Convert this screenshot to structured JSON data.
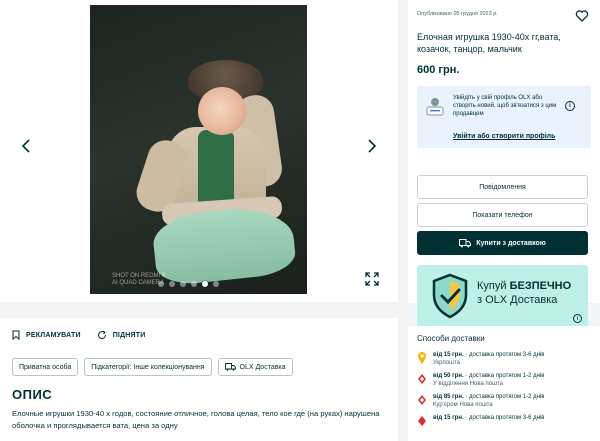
{
  "gallery": {
    "watermark": "SHOT ON REDMI 9\nAI QUAD CAMERA",
    "slide_count": 6,
    "active_slide": 5,
    "prev_icon": "chevron-left-icon",
    "next_icon": "chevron-right-icon",
    "expand_icon": "expand-icon"
  },
  "actions": {
    "promote": "РЕКЛАМУВАТИ",
    "raise": "ПІДНЯТИ"
  },
  "tags": [
    "Приватна особа",
    "Підкатегорії: Інше колекціонування",
    "OLX Доставка"
  ],
  "description": {
    "heading": "ОПИС",
    "text": "Елочные игрушки 1930-40 х годов, состояние отличное, голова целая, тело кое где (на руках) нарушена оболочка и проглядывается вата, цена за одну"
  },
  "listing": {
    "published": "Опубліковано 05 грудня 2023 р.",
    "title": "Елочная игрушка 1930-40х гг,вата, козачок, танцор, мальчик",
    "price": "600 грн."
  },
  "login_prompt": {
    "text": "Увійдіть у свій профіль OLX або створіть новий, щоб зв'язатися з цим продавцем",
    "link": "Увійти або створити профіль"
  },
  "buttons": {
    "message": "Повідомлення",
    "phone": "Показати телефон",
    "buy": "Купити з доставкою"
  },
  "banner": {
    "line1_prefix": "Купуй ",
    "line1_bold": "БЕЗПЕЧНО",
    "line2": "з OLX Доставка"
  },
  "delivery": {
    "title": "Способи доставки",
    "items": [
      {
        "price": "від 15 грн.",
        "text": " · доставка протягом 3-6 днів",
        "carrier": "Укрпошта",
        "color": "#f6b319"
      },
      {
        "price": "від 50 грн.",
        "text": " · доставка протягом 1-2 днів",
        "carrier": "У відділення Нова пошта",
        "color": "#d62e2e"
      },
      {
        "price": "від 85 грн.",
        "text": " · доставка протягом 1-2 днів",
        "carrier": "Кур'єром Нова пошта",
        "color": "#d62e2e"
      },
      {
        "price": "від 15 грн.",
        "text": " · доставка протягом 3-6 днів",
        "carrier": "",
        "color": "#d62e2e"
      }
    ]
  },
  "colors": {
    "brand_dark": "#002f34",
    "banner_bg": "#bdf0e6",
    "login_bg": "#e9f2fd"
  }
}
